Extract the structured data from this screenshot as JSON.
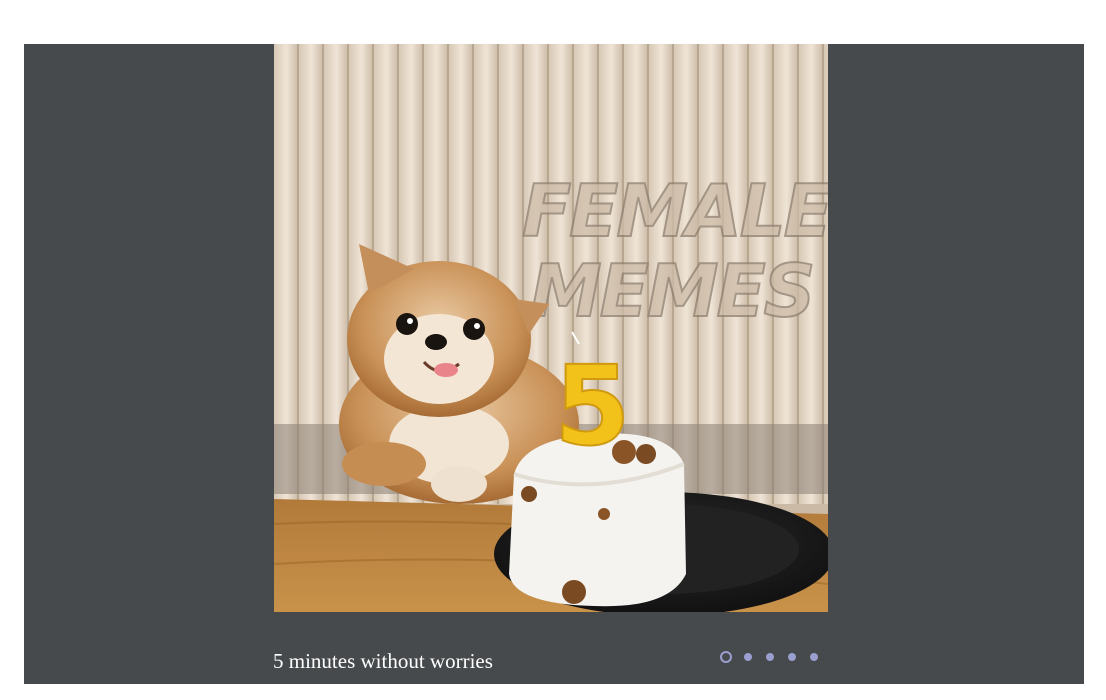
{
  "slider": {
    "caption": "5 minutes without worries",
    "image": {
      "subject": "dog-birthday-cake-photo",
      "watermark": [
        "FEMALE",
        "MEMES"
      ],
      "candle_number": "5"
    },
    "dots": {
      "count": 5,
      "active_index": 0
    },
    "colors": {
      "background": "#474a4c",
      "dot": "#9b9fd0",
      "caption": "#ffffff"
    }
  }
}
